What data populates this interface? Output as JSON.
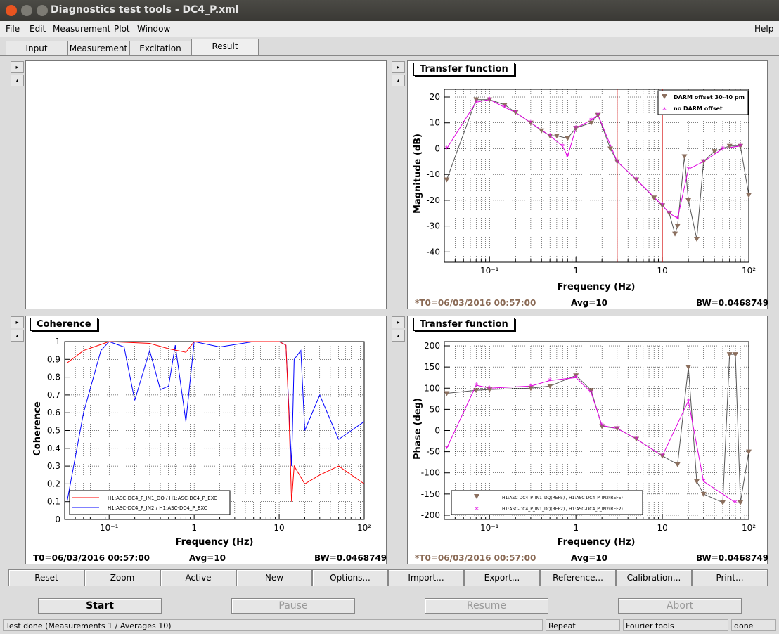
{
  "window": {
    "title": "Diagnostics test tools - DC4_P.xml"
  },
  "menu": {
    "items": [
      "File",
      "Edit",
      "Measurement",
      "Plot",
      "Window"
    ],
    "help": "Help"
  },
  "tabs": [
    "Input",
    "Measurement",
    "Excitation",
    "Result"
  ],
  "panels": {
    "top_right": {
      "title": "Transfer function",
      "ylabel": "Magnitude (dB)",
      "xlabel": "Frequency (Hz)",
      "yticks": [
        "20",
        "10",
        "0",
        "-10",
        "-20",
        "-30",
        "-40"
      ],
      "xticks": [
        "10⁻¹",
        "1",
        "10",
        "10²"
      ],
      "legend": [
        "DARM offset 30-40 pm",
        "no DARM offset"
      ],
      "footer": {
        "t0": "*T0=06/03/2016 00:57:00",
        "avg": "Avg=10",
        "bw": "BW=0.0468749"
      }
    },
    "bottom_left": {
      "title": "Coherence",
      "ylabel": "Coherence",
      "xlabel": "Frequency (Hz)",
      "yticks": [
        "1",
        "0.9",
        "0.8",
        "0.7",
        "0.6",
        "0.5",
        "0.4",
        "0.3",
        "0.2",
        "0.1",
        "0"
      ],
      "xticks": [
        "10⁻¹",
        "1",
        "10",
        "10²"
      ],
      "legend": [
        "H1:ASC-DC4_P_IN1_DQ / H1:ASC-DC4_P_EXC",
        "H1:ASC-DC4_P_IN2 / H1:ASC-DC4_P_EXC"
      ],
      "footer": {
        "t0": "T0=06/03/2016 00:57:00",
        "avg": "Avg=10",
        "bw": "BW=0.0468749"
      }
    },
    "bottom_right": {
      "title": "Transfer function",
      "ylabel": "Phase (deg)",
      "xlabel": "Frequency (Hz)",
      "yticks": [
        "200",
        "150",
        "100",
        "50",
        "0",
        "-50",
        "-100",
        "-150",
        "-200"
      ],
      "xticks": [
        "10⁻¹",
        "1",
        "10",
        "10²"
      ],
      "legend": [
        "H1:ASC-DC4_P_IN1_DQ(REF5) / H1:ASC-DC4_P_IN2(REF5)",
        "H1:ASC-DC4_P_IN1_DQ(REF2) / H1:ASC-DC4_P_IN2(REF2)"
      ],
      "footer": {
        "t0": "*T0=06/03/2016 00:57:00",
        "avg": "Avg=10",
        "bw": "BW=0.0468749"
      }
    }
  },
  "buttons": [
    "Reset",
    "Zoom",
    "Active",
    "New",
    "Options...",
    "Import...",
    "Export...",
    "Reference...",
    "Calibration...",
    "Print..."
  ],
  "controls": {
    "start": "Start",
    "pause": "Pause",
    "resume": "Resume",
    "abort": "Abort"
  },
  "status": {
    "main": "Test done (Measurements 1 / Averages 10)",
    "repeat": "Repeat",
    "tools": "Fourier tools",
    "state": "done"
  },
  "colors": {
    "ref_brown": "#8b6f5e",
    "ref_magenta": "#e000e0",
    "coh_red": "#ff0000",
    "coh_blue": "#0000ff"
  },
  "chart_data": [
    {
      "type": "scatter",
      "title": "Transfer function",
      "xlabel": "Frequency (Hz)",
      "ylabel": "Magnitude (dB)",
      "xscale": "log",
      "xlim": [
        0.03,
        100
      ],
      "ylim": [
        -44,
        23
      ],
      "legend_position": "top-right",
      "grid": true,
      "series": [
        {
          "name": "DARM offset 30-40 pm",
          "x": [
            0.032,
            0.07,
            0.1,
            0.15,
            0.2,
            0.3,
            0.4,
            0.5,
            0.6,
            0.8,
            1,
            1.5,
            1.8,
            2.5,
            3,
            5,
            8,
            10,
            12,
            14,
            15,
            18,
            20,
            25,
            30,
            40,
            60,
            80,
            100
          ],
          "y": [
            -12,
            19,
            19,
            17,
            14,
            10,
            7,
            5,
            5,
            4,
            8,
            10,
            13,
            0,
            -5,
            -12,
            -19,
            -22,
            -25,
            -33,
            -30,
            -3,
            -20,
            -35,
            -5,
            -1,
            1,
            1,
            -18
          ]
        },
        {
          "name": "no DARM offset",
          "x": [
            0.032,
            0.07,
            0.1,
            0.15,
            0.2,
            0.3,
            0.5,
            0.7,
            0.8,
            1,
            1.5,
            1.8,
            3,
            5,
            10,
            12,
            15,
            20,
            30,
            50,
            80
          ],
          "y": [
            0,
            18,
            19,
            16,
            14,
            10,
            5,
            1,
            -3,
            8,
            11,
            13,
            -5,
            -12,
            -22,
            -25,
            -27,
            -8,
            -5,
            0,
            1
          ]
        }
      ],
      "annotations": [
        "vertical line at 3 Hz",
        "vertical line at 10 Hz"
      ]
    },
    {
      "type": "line",
      "title": "Coherence",
      "xlabel": "Frequency (Hz)",
      "ylabel": "Coherence",
      "xscale": "log",
      "xlim": [
        0.03,
        100
      ],
      "ylim": [
        0,
        1
      ],
      "legend_position": "bottom-left",
      "grid": true,
      "series": [
        {
          "name": "H1:ASC-DC4_P_IN1_DQ / H1:ASC-DC4_P_EXC",
          "x": [
            0.032,
            0.05,
            0.1,
            0.3,
            0.5,
            0.8,
            1,
            5,
            10,
            12,
            13,
            14,
            15,
            20,
            30,
            50,
            100
          ],
          "y": [
            0.88,
            0.95,
            1,
            0.99,
            0.96,
            0.94,
            1,
            1,
            1,
            0.98,
            0.6,
            0.1,
            0.3,
            0.2,
            0.25,
            0.3,
            0.2
          ]
        },
        {
          "name": "H1:ASC-DC4_P_IN2 / H1:ASC-DC4_P_EXC",
          "x": [
            0.032,
            0.05,
            0.08,
            0.1,
            0.15,
            0.2,
            0.3,
            0.4,
            0.5,
            0.6,
            0.8,
            1,
            2,
            5,
            10,
            12,
            14,
            15,
            18,
            20,
            30,
            50,
            100
          ],
          "y": [
            0.1,
            0.6,
            0.95,
            1,
            0.97,
            0.67,
            0.95,
            0.73,
            0.75,
            0.98,
            0.55,
            1,
            0.97,
            1,
            1,
            0.98,
            0.3,
            0.9,
            0.95,
            0.5,
            0.7,
            0.45,
            0.55
          ]
        }
      ]
    },
    {
      "type": "scatter",
      "title": "Transfer function",
      "xlabel": "Frequency (Hz)",
      "ylabel": "Phase (deg)",
      "xscale": "log",
      "xlim": [
        0.03,
        100
      ],
      "ylim": [
        -210,
        210
      ],
      "legend_position": "bottom-left",
      "grid": true,
      "series": [
        {
          "name": "H1:ASC-DC4_P_IN1_DQ(REF5) / H1:ASC-DC4_P_IN2(REF5)",
          "x": [
            0.032,
            0.07,
            0.1,
            0.3,
            0.5,
            1,
            1.5,
            2,
            3,
            5,
            10,
            15,
            20,
            25,
            30,
            50,
            60,
            70,
            80,
            100
          ],
          "y": [
            88,
            95,
            97,
            100,
            105,
            130,
            95,
            10,
            5,
            -20,
            -60,
            -80,
            150,
            -120,
            -150,
            -170,
            180,
            180,
            -170,
            -50
          ]
        },
        {
          "name": "H1:ASC-DC4_P_IN1_DQ(REF2) / H1:ASC-DC4_P_IN2(REF2)",
          "x": [
            0.032,
            0.07,
            0.1,
            0.3,
            0.5,
            1,
            1.5,
            2,
            3,
            5,
            10,
            20,
            30,
            70
          ],
          "y": [
            -42,
            107,
            100,
            105,
            118,
            125,
            90,
            12,
            5,
            -20,
            -60,
            70,
            -120,
            -170
          ]
        }
      ]
    }
  ]
}
